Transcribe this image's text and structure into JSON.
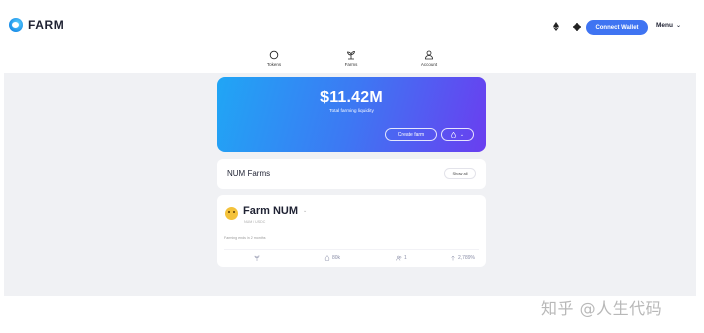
{
  "header": {
    "logo_text": "FARM",
    "connect_wallet": "Connect Wallet",
    "menu": "Menu",
    "icons": [
      "ethereum-icon",
      "sun-icon"
    ]
  },
  "nav": {
    "tokens": "Tokens",
    "farms": "Farms",
    "account": "Account"
  },
  "hero": {
    "amount": "$11.42M",
    "subtitle": "Total farming liquidity",
    "create_farm": "Create farm"
  },
  "farms_section": {
    "title": "NUM Farms",
    "show_all": "Show all"
  },
  "farm": {
    "name": "Farm NUM",
    "pair": "NUM / USDC",
    "ends": "Farming ends in 2 months",
    "stats": {
      "liquidity": "80k",
      "users": "1",
      "apy": "2,789%"
    }
  },
  "watermark": "知乎 @人生代码",
  "colors": {
    "accent": "#3f74f2",
    "hero_start": "#20a6f5",
    "hero_end": "#6a3ef0",
    "background": "#f0f1f4"
  }
}
